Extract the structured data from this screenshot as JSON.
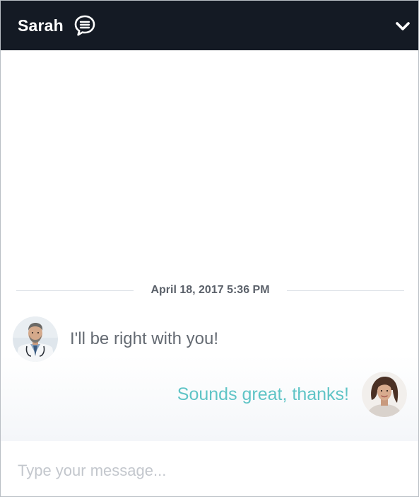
{
  "header": {
    "agent_name": "Sarah",
    "chat_icon": "chat-bubble-icon",
    "collapse_icon": "chevron-down-icon",
    "background_color": "#141a24"
  },
  "conversation": {
    "timestamp": "April 18, 2017 5:36 PM",
    "messages": [
      {
        "sender": "agent",
        "avatar": "agent-avatar",
        "text": "I'll be right with you!"
      },
      {
        "sender": "user",
        "avatar": "user-avatar",
        "text": "Sounds great, thanks!"
      }
    ],
    "user_text_color": "#5fc4c6",
    "agent_text_color": "#656b73"
  },
  "composer": {
    "placeholder": "Type your message...",
    "value": ""
  }
}
